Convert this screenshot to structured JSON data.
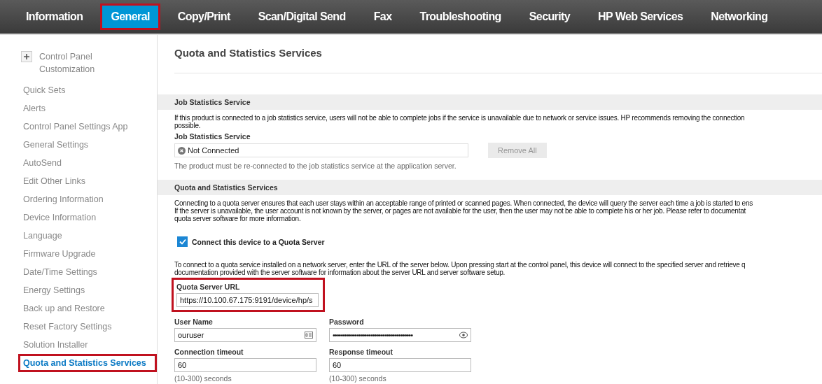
{
  "tabs": [
    {
      "label": "Information",
      "selected": false,
      "highlighted": false
    },
    {
      "label": "General",
      "selected": true,
      "highlighted": true
    },
    {
      "label": "Copy/Print",
      "selected": false,
      "highlighted": false
    },
    {
      "label": "Scan/Digital Send",
      "selected": false,
      "highlighted": false
    },
    {
      "label": "Fax",
      "selected": false,
      "highlighted": false
    },
    {
      "label": "Troubleshooting",
      "selected": false,
      "highlighted": false
    },
    {
      "label": "Security",
      "selected": false,
      "highlighted": false
    },
    {
      "label": "HP Web Services",
      "selected": false,
      "highlighted": false
    },
    {
      "label": "Networking",
      "selected": false,
      "highlighted": false
    }
  ],
  "sidebar": {
    "group": {
      "label": "Control Panel Customization",
      "expanded": false
    },
    "items": [
      {
        "label": "Quick Sets",
        "selected": false,
        "highlighted": false
      },
      {
        "label": "Alerts",
        "selected": false,
        "highlighted": false
      },
      {
        "label": "Control Panel Settings App",
        "selected": false,
        "highlighted": false
      },
      {
        "label": "General Settings",
        "selected": false,
        "highlighted": false
      },
      {
        "label": "AutoSend",
        "selected": false,
        "highlighted": false
      },
      {
        "label": "Edit Other Links",
        "selected": false,
        "highlighted": false
      },
      {
        "label": "Ordering Information",
        "selected": false,
        "highlighted": false
      },
      {
        "label": "Device Information",
        "selected": false,
        "highlighted": false
      },
      {
        "label": "Language",
        "selected": false,
        "highlighted": false
      },
      {
        "label": "Firmware Upgrade",
        "selected": false,
        "highlighted": false
      },
      {
        "label": "Date/Time Settings",
        "selected": false,
        "highlighted": false
      },
      {
        "label": "Energy Settings",
        "selected": false,
        "highlighted": false
      },
      {
        "label": "Back up and Restore",
        "selected": false,
        "highlighted": false
      },
      {
        "label": "Reset Factory Settings",
        "selected": false,
        "highlighted": false
      },
      {
        "label": "Solution Installer",
        "selected": false,
        "highlighted": false
      },
      {
        "label": "Quota and Statistics Services",
        "selected": true,
        "highlighted": true
      }
    ]
  },
  "page_title": "Quota and Statistics Services",
  "job_section": {
    "heading": "Job Statistics Service",
    "description": [
      "If this product is connected to a job statistics service, users will not be able to complete jobs if the service is unavailable due to network or service issues. HP recommends removing the connection",
      "possible."
    ],
    "field_label": "Job Statistics Service",
    "status": "Not Connected",
    "button": {
      "label": "Remove All",
      "disabled": true
    },
    "hint": "The product must be re-connected to the job statistics service at the application server."
  },
  "quota_section": {
    "heading": "Quota and Statistics Services",
    "description": [
      "Connecting to a quota server ensures that each user stays within an acceptable range of printed or scanned pages. When connected, the device will query the server each time a job is started to ens",
      "If the server is unavailable, the user account is not known by the server, or pages are not available for the user, then the user may not be able to complete his or her job. Please refer to documentat",
      "quota server software for more information."
    ],
    "checkbox": {
      "label": "Connect this device to a Quota Server",
      "checked": true
    },
    "instructions": [
      "To connect to a quota service installed on a network server, enter the URL of the server below. Upon pressing start at the control panel, this device will connect to the specified server and retrieve q",
      "documentation provided with the server software for information about the server URL and server software setup."
    ],
    "url": {
      "label": "Quota Server URL",
      "value": "https://10.100.67.175:9191/device/hp/s",
      "highlighted": true
    },
    "user_name": {
      "label": "User Name",
      "value": "ouruser"
    },
    "password": {
      "label": "Password",
      "value": "••••••••••••••••••••••••••••••••••••••••"
    },
    "connection_timeout": {
      "label": "Connection timeout",
      "value": "60",
      "hint": "(10-300) seconds"
    },
    "response_timeout": {
      "label": "Response timeout",
      "value": "60",
      "hint": "(10-300) seconds"
    }
  }
}
